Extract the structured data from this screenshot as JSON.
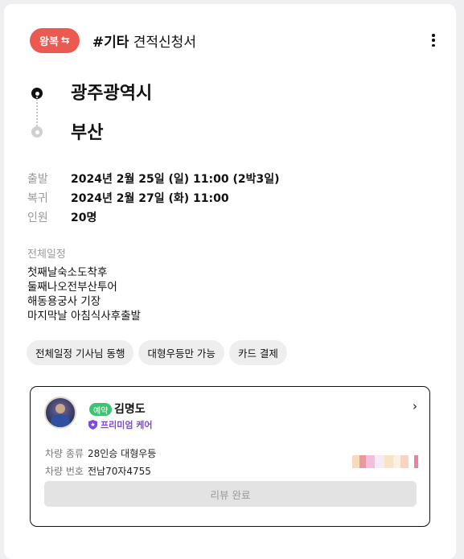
{
  "header": {
    "trip_type": "왕복",
    "trip_icon": "swap-icon",
    "category_tag": "#기타",
    "title": "견적신청서"
  },
  "route": {
    "from": "광주광역시",
    "to": "부산"
  },
  "info": [
    {
      "label": "출발",
      "value": "2024년 2월 25일 (일) 11:00 (2박3일)"
    },
    {
      "label": "복귀",
      "value": "2024년 2월 27일 (화) 11:00"
    },
    {
      "label": "인원",
      "value": "20명"
    }
  ],
  "schedule": {
    "label": "전체일정",
    "lines": [
      "첫째날숙소도착후",
      "둘째나오전부산투어",
      "해동용궁사 기장",
      "마지막날 아침식사후출발"
    ]
  },
  "chips": [
    "전체일정 기사님 동행",
    "대형우등만 가능",
    "카드 결제"
  ],
  "driver": {
    "status": "예약",
    "name": "김명도",
    "badge": "프리미엄 케어",
    "vehicle_type_label": "차량 종류",
    "vehicle_type": "28인승 대형우등",
    "vehicle_number_label": "차량 번호",
    "vehicle_number": "전남70자4755",
    "review_button": "리뷰 완료"
  },
  "colors": {
    "trip_badge": "#ea5a50",
    "reservation_badge": "#3cc373",
    "premium": "#7b4ad6"
  }
}
